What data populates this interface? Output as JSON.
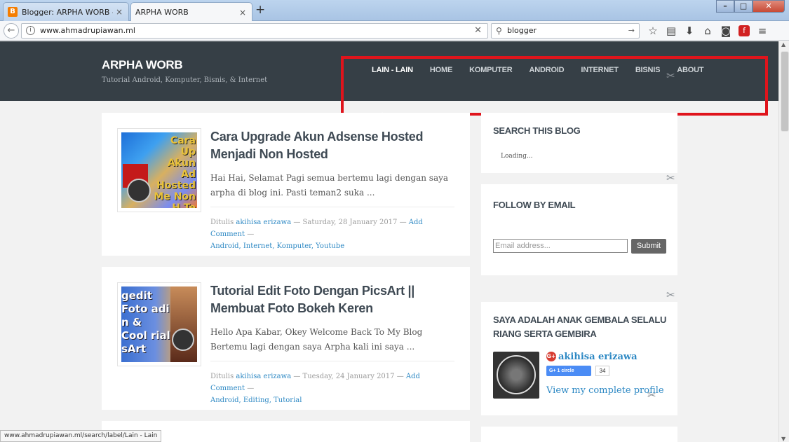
{
  "browser": {
    "tabs": [
      {
        "title": "Blogger: ARPHA WORB - T...",
        "close": "×",
        "favicon": "B"
      },
      {
        "title": "ARPHA WORB",
        "close": "×"
      }
    ],
    "new_tab": "+",
    "url": "www.ahmadrupiawan.ml",
    "search_value": "blogger",
    "status_url": "www.ahmadrupiawan.ml/search/label/Lain - Lain",
    "icons": [
      "back-icon",
      "info-icon",
      "clear-icon",
      "search-icon",
      "go-icon",
      "star-icon",
      "reader-icon",
      "download-icon",
      "home-icon",
      "pocket-icon",
      "flash-icon",
      "menu-icon"
    ]
  },
  "site": {
    "title": "ARPHA WORB",
    "description": "Tutorial Android, Komputer, Bisnis, & Internet",
    "menu": [
      "LAIN - LAIN",
      "HOME",
      "KOMPUTER",
      "ANDROID",
      "INTERNET",
      "BISNIS",
      "ABOUT"
    ]
  },
  "posts": [
    {
      "title": "Cara Upgrade Akun Adsense Hosted Menjadi Non Hosted",
      "snippet": "Hai Hai, Selamat Pagi semua bertemu lagi dengan saya arpha di blog ini. Pasti teman2 suka ...",
      "meta_prefix": "Ditulis",
      "author": "akihisa erizawa",
      "date": "— Saturday, 28 January 2017 —",
      "comment": "Add Comment",
      "labels_line": "Android, Internet, Komputer, Youtube",
      "thumb_text": "Cara Up Akun Ad Hosted Me Non H Te"
    },
    {
      "title": "Tutorial Edit Foto Dengan PicsArt || Membuat Foto Bokeh Keren",
      "snippet": "Hello Apa Kabar, Okey Welcome Back To My Blog Bertemu lagi dengan saya Arpha kali ini saya ...",
      "meta_prefix": "Ditulis",
      "author": "akihisa erizawa",
      "date": "— Tuesday, 24 January 2017 —",
      "comment": "Add Comment",
      "labels_line": "Android, Editing, Tutorial",
      "thumb_text": "gedit Foto adi n & Cool rial sArt"
    }
  ],
  "sidebar": {
    "search_title": "SEARCH THIS BLOG",
    "loading": "Loading...",
    "follow_title": "FOLLOW BY EMAIL",
    "email_placeholder": "Email address...",
    "submit": "Submit",
    "profile_title": "SAYA ADALAH ANAK GEMBALA SELALU RIANG SERTA GEMBIRA",
    "profile_name": "akihisa erizawa",
    "gplus_badge": "G+   1 circle",
    "gplus_count": "34",
    "profile_link": "View my complete profile"
  },
  "colors": {
    "header_bg": "#363f46",
    "highlight": "#e0141c",
    "link": "#2e89c4"
  }
}
